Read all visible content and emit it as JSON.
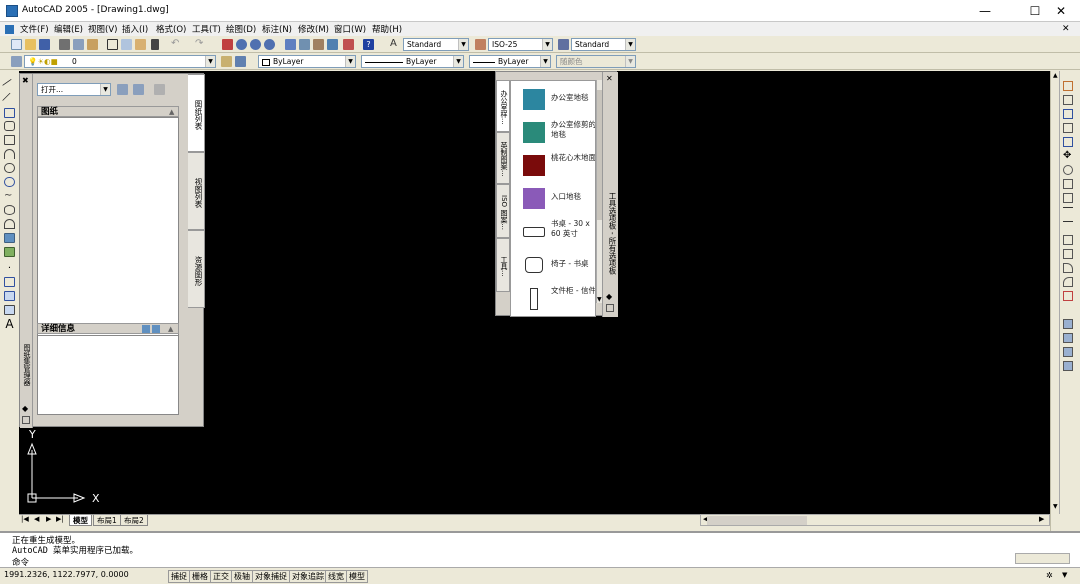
{
  "window": {
    "title": "AutoCAD 2005 - [Drawing1.dwg]",
    "minimize": "—",
    "maximize": "☐",
    "close": "✕"
  },
  "menu": [
    "文件(F)",
    "编辑(E)",
    "视图(V)",
    "插入(I)",
    "格式(O)",
    "工具(T)",
    "绘图(D)",
    "标注(N)",
    "修改(M)",
    "窗口(W)",
    "帮助(H)"
  ],
  "toolbar": {
    "text_style": "Standard",
    "dim_style": "ISO-25",
    "table_style": "Standard",
    "layer": "0",
    "color": "ByLayer",
    "linetype": "ByLayer",
    "lineweight": "ByLayer",
    "plotstyle": "随颜色"
  },
  "design_center": {
    "open_combo": "打开...",
    "sheet_header": "图纸",
    "detail_header": "详细信息",
    "tabs": [
      "图纸列表",
      "视图列表",
      "资源图形"
    ],
    "strip_label": "图纸集管理器"
  },
  "tool_palette": {
    "tabs": [
      "办公室样...",
      "英制图案...",
      "ISO 图案...",
      "工具..."
    ],
    "caption": "工具选项板 - 所有选项板",
    "items": [
      {
        "label": "办公室地毯",
        "color": "#2c86a0"
      },
      {
        "label": "办公室修剪的地毯",
        "color": "#2a8a7a"
      },
      {
        "label": "桃花心木地面",
        "color": "#7a0b0b"
      },
      {
        "label": "入口地毯",
        "color": "#8a5ab8"
      },
      {
        "label": "书桌 - 30 x 60 英寸",
        "icon": "desk-icon"
      },
      {
        "label": "椅子 - 书桌",
        "icon": "chair-icon"
      },
      {
        "label": "文件柜 - 信件",
        "icon": "cabinet-icon"
      }
    ]
  },
  "ucs": {
    "y": "Y",
    "x": "X"
  },
  "layout_tabs": [
    "模型",
    "布局1",
    "布局2"
  ],
  "command": {
    "lines": [
      "正在重生成模型。",
      "AutoCAD 菜单实用程序已加载。",
      "命令"
    ]
  },
  "status": {
    "coords": "1991.2326, 1122.7977, 0.0000",
    "buttons": [
      "捕捉",
      "栅格",
      "正交",
      "极轴",
      "对象捕捉",
      "对象追踪",
      "线宽",
      "模型"
    ]
  }
}
